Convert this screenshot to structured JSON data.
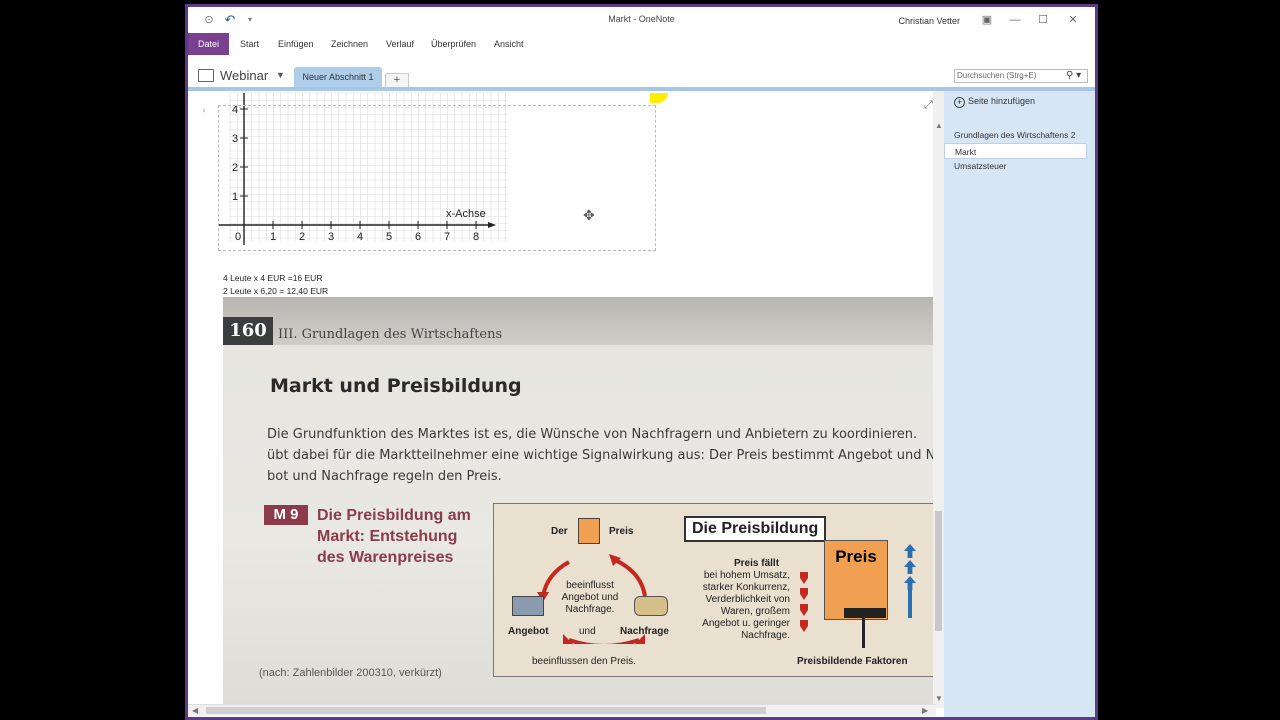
{
  "window": {
    "title": "Markt  -  OneNote",
    "user": "Christian Vetter",
    "back_icon": "back-icon",
    "undo_icon": "undo-icon"
  },
  "ribbon": {
    "tabs": [
      "Datei",
      "Start",
      "Einfügen",
      "Zeichnen",
      "Verlauf",
      "Überprüfen",
      "Ansicht"
    ]
  },
  "notebook": {
    "name": "Webinar",
    "section_tab": "Neuer Abschnitt 1",
    "add_section": "+",
    "search_placeholder": "Durchsuchen (Strg+E)"
  },
  "pages_panel": {
    "add_page": "Seite hinzufügen",
    "items": [
      "Grundlagen des Wirtschaftens 2",
      "Markt",
      "Umsatzsteuer"
    ],
    "active_index": 1
  },
  "graph": {
    "y_ticks": [
      "4",
      "3",
      "2",
      "1"
    ],
    "x_ticks": [
      "0",
      "1",
      "2",
      "3",
      "4",
      "5",
      "6",
      "7",
      "8"
    ],
    "x_label": "x-Achse"
  },
  "notes": {
    "line1": "4 Leute x 4 EUR =16 EUR",
    "line2": "2 Leute x 6,20 = 12,40 EUR"
  },
  "photo": {
    "page_number": "160",
    "chapter": "III. Grundlagen des Wirtschaftens",
    "heading": "Markt und Preisbildung",
    "para_line1": "Die Grundfunktion des Marktes ist es, die Wünsche von Nachfragern und Anbietern zu koordinieren.",
    "para_line2": "übt dabei für die Marktteilnehmer eine wichtige Signalwirkung aus: Der Preis bestimmt Angebot und N",
    "para_line3": "bot und Nachfrage regeln den Preis.",
    "m9_badge": "M 9",
    "m9_title": "Die Preisbildung am Markt: Entstehung des Warenpreises",
    "source": "(nach: Zahlenbilder 200310, verkürzt)",
    "diagram": {
      "title": "Die Preisbildung",
      "der": "Der",
      "preis_word": "Preis",
      "center_text": "beeinflusst Angebot und Nachfrage.",
      "angebot": "Angebot",
      "und": "und",
      "nachfrage": "Nachfrage",
      "bottom_text": "beeinflussen den Preis.",
      "preis_faellt": "Preis fällt",
      "faellt_reasons": "bei hohem Umsatz, starker Konkurrenz, Verderblichkeit von Waren, großem Angebot u. geringer Nachfrage.",
      "sign_label": "Preis",
      "factors": "Preisbildende Faktoren"
    }
  }
}
